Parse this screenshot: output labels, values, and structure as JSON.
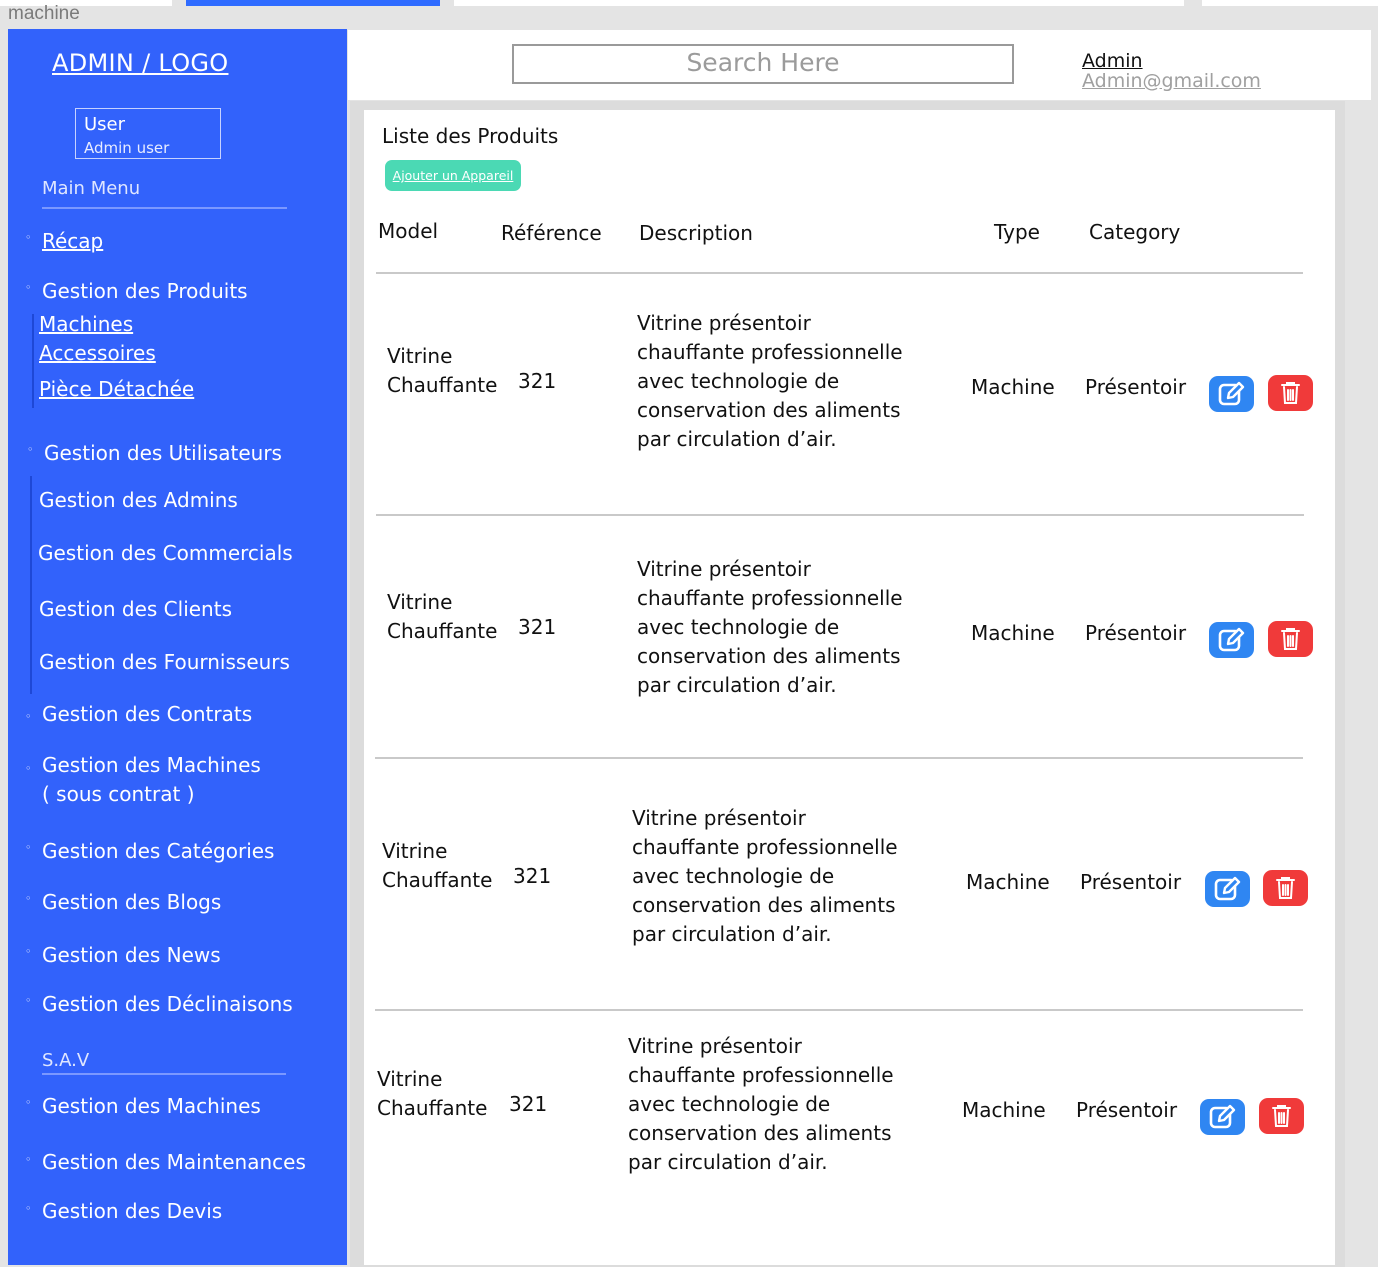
{
  "frame": {
    "label": "machine"
  },
  "sidebar": {
    "logo": "ADMIN / LOGO",
    "user": {
      "name": "User",
      "role": "Admin user"
    },
    "main_menu_title": "Main Menu",
    "recap": "Récap",
    "produits": {
      "label": "Gestion des Produits",
      "sub": [
        "Machines",
        "Accessoires",
        "Pièce Détachée"
      ]
    },
    "utilisateurs": {
      "label": "Gestion des Utilisateurs",
      "sub": [
        "Gestion des Admins",
        "Gestion des Commercials",
        "Gestion des Clients",
        "Gestion des Fournisseurs"
      ]
    },
    "contrats": "Gestion des Contrats",
    "machines_contrat": {
      "line1": "Gestion des Machines",
      "line2": "( sous contrat )"
    },
    "categories": "Gestion des Catégories",
    "blogs": "Gestion des Blogs",
    "news": "Gestion des News",
    "declinaisons": "Gestion des Déclinaisons",
    "sav_title": "S.A.V",
    "sav": [
      "Gestion des Machines",
      "Gestion des Maintenances",
      "Gestion des Devis"
    ]
  },
  "header": {
    "search_placeholder": "Search Here",
    "admin_name": "Admin",
    "admin_email": "Admin@gmail.com"
  },
  "main": {
    "title": "Liste des Produits",
    "add_button": "Ajouter un Appareil",
    "columns": [
      "Model",
      "Référence",
      "Description",
      "Type",
      "Category"
    ],
    "rows": [
      {
        "model_1": "Vitrine",
        "model_2": "Chauffante",
        "reference": "321",
        "desc": [
          "Vitrine présentoir",
          "chauffante professionnelle",
          "avec technologie de",
          "conservation des aliments",
          "par circulation d’air."
        ],
        "type": "Machine",
        "category": "Présentoir"
      },
      {
        "model_1": "Vitrine",
        "model_2": "Chauffante",
        "reference": "321",
        "desc": [
          "Vitrine présentoir",
          "chauffante professionnelle",
          "avec technologie de",
          "conservation des aliments",
          "par circulation d’air."
        ],
        "type": "Machine",
        "category": "Présentoir"
      },
      {
        "model_1": "Vitrine",
        "model_2": "Chauffante",
        "reference": "321",
        "desc": [
          "Vitrine présentoir",
          "chauffante professionnelle",
          "avec technologie de",
          "conservation des aliments",
          "par circulation d’air."
        ],
        "type": "Machine",
        "category": "Présentoir"
      },
      {
        "model_1": "Vitrine",
        "model_2": "Chauffante",
        "reference": "321",
        "desc": [
          "Vitrine présentoir",
          "chauffante professionnelle",
          "avec technologie de",
          "conservation des aliments",
          "par circulation d’air."
        ],
        "type": "Machine",
        "category": "Présentoir"
      }
    ]
  },
  "icons": {
    "edit": "edit-icon",
    "delete": "trash-icon"
  },
  "colors": {
    "sidebar": "#3262fb",
    "add_button": "#4bd9b4",
    "edit": "#2f86f2",
    "delete": "#f03a3a"
  }
}
